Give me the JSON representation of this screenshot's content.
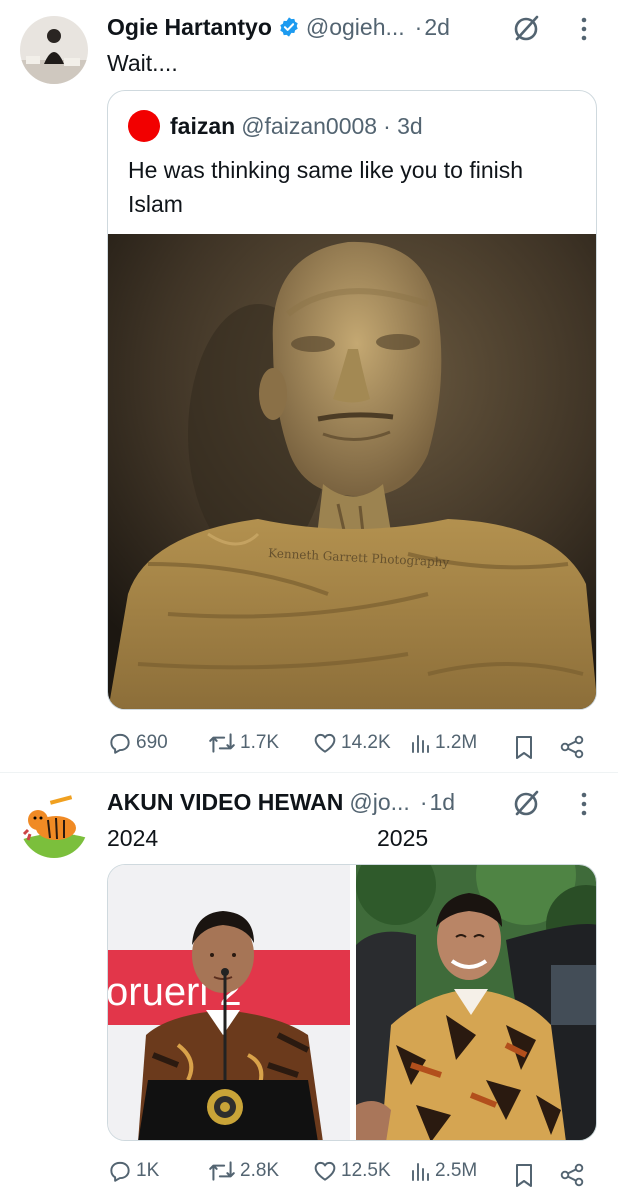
{
  "tweets": [
    {
      "name": "Ogie Hartantyo",
      "verified": true,
      "handle": "@ogieh...",
      "separator": "·",
      "time": "2d",
      "text": "Wait....",
      "quote": {
        "name": "faizan",
        "handle": "@faizan0008",
        "time": "· 3d",
        "text": "He was thinking same like you to finish Islam",
        "image_watermark": "Kenneth Garrett Photography"
      },
      "stats": {
        "replies": "690",
        "reposts": "1.7K",
        "likes": "14.2K",
        "views": "1.2M"
      }
    },
    {
      "name": "AKUN VIDEO HEWAN",
      "handle": "@jo...",
      "separator": "·",
      "time": "1d",
      "text_left": "2024",
      "text_right": "2025",
      "left_banner_text": "orueri 2",
      "stats": {
        "replies": "1K",
        "reposts": "2.8K",
        "likes": "12.5K",
        "views": "2.5M"
      }
    }
  ],
  "colors": {
    "text": "#0f1419",
    "muted": "#536471",
    "verified": "#1d9bf0",
    "border": "#cfd9de",
    "quote_avatar": "#f20000"
  },
  "icons": [
    "verified-badge-icon",
    "grok-icon",
    "more-icon",
    "reply-icon",
    "repost-icon",
    "like-icon",
    "views-icon",
    "bookmark-icon",
    "share-icon"
  ]
}
